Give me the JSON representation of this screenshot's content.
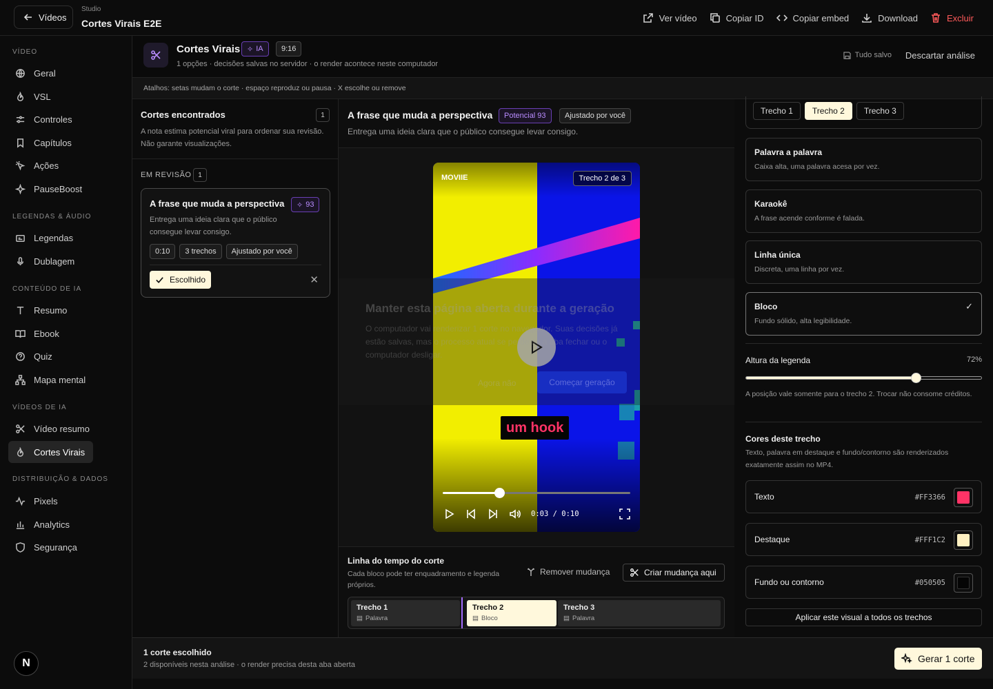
{
  "topbar": {
    "back_label": "Vídeos",
    "crumb_sub": "Studio",
    "crumb_title": "Cortes Virais E2E",
    "actions": [
      {
        "label": "Ver vídeo",
        "icon": "external-link-icon"
      },
      {
        "label": "Copiar ID",
        "icon": "copy-icon"
      },
      {
        "label": "Copiar embed",
        "icon": "code-icon"
      },
      {
        "label": "Download",
        "icon": "download-icon"
      },
      {
        "label": "Excluir",
        "icon": "trash-icon"
      }
    ]
  },
  "sidebar": {
    "sections": [
      {
        "title": "VÍDEO",
        "items": [
          "Geral",
          "VSL",
          "Controles",
          "Capítulos",
          "Ações",
          "PauseBoost"
        ]
      },
      {
        "title": "LEGENDAS & ÁUDIO",
        "items": [
          "Legendas",
          "Dublagem"
        ]
      },
      {
        "title": "CONTEÚDO DE IA",
        "items": [
          "Resumo",
          "Ebook",
          "Quiz",
          "Mapa mental"
        ]
      },
      {
        "title": "VÍDEOS DE IA",
        "items": [
          "Vídeo resumo",
          "Cortes Virais"
        ]
      },
      {
        "title": "DISTRIBUIÇÃO & DADOS",
        "items": [
          "Pixels",
          "Analytics",
          "Segurança"
        ]
      }
    ],
    "active": "Cortes Virais",
    "logo_letter": "N"
  },
  "header": {
    "title": "Cortes Virais",
    "tag_ia": "IA",
    "tag_ratio": "9:16",
    "subtitle": "1 opções · decisões salvas no servidor · o render acontece neste computador",
    "saved": "Tudo salvo",
    "discard": "Descartar análise"
  },
  "shortcuts": "Atalhos: setas mudam o corte · espaço reproduz ou pausa · X escolhe ou remove",
  "left_panel": {
    "title": "Cortes encontrados",
    "count": "1",
    "desc": "A nota estima potencial viral para ordenar sua revisão. Não garante visualizações.",
    "review_label": "EM REVISÃO",
    "review_count": "1",
    "card": {
      "title": "A frase que muda a perspectiva",
      "score": "93",
      "desc": "Entrega uma ideia clara que o público consegue levar consigo.",
      "chips": [
        "0:10",
        "3 trechos",
        "Ajustado por você"
      ],
      "chosen_label": "Escolhido"
    }
  },
  "center": {
    "title": "A frase que muda a perspectiva",
    "potential": "Potencial 93",
    "adjusted": "Ajustado por você",
    "desc": "Entrega uma ideia clara que o público consegue levar consigo.",
    "video": {
      "brand": "MOVIIE",
      "segment_badge": "Trecho 2 de 3",
      "caption": "um hook",
      "time": "0:03 / 0:10",
      "progress": 0.3
    },
    "overlay": {
      "title": "Manter esta página aberta durante a geração",
      "desc": "O computador vai renderizar 1 corte no navegador. Suas decisões já estão salvas, mas o processo atual se perde se a aba fechar ou o computador desligar.",
      "btn_no": "Agora não",
      "btn_start": "Começar geração"
    },
    "timeline": {
      "title": "Linha do tempo do corte",
      "desc": "Cada bloco pode ter enquadramento e legenda próprios.",
      "remove": "Remover mudança",
      "create": "Criar mudança aqui",
      "segments": [
        {
          "name": "Trecho 1",
          "style": "Palavra"
        },
        {
          "name": "Trecho 2",
          "style": "Bloco"
        },
        {
          "name": "Trecho 3",
          "style": "Palavra"
        }
      ]
    }
  },
  "right_panel": {
    "tabs": [
      "Trecho 1",
      "Trecho 2",
      "Trecho 3"
    ],
    "active_tab": "Trecho 2",
    "styles": [
      {
        "name": "Palavra a palavra",
        "desc": "Caixa alta, uma palavra acesa por vez."
      },
      {
        "name": "Karaokê",
        "desc": "A frase acende conforme é falada."
      },
      {
        "name": "Linha única",
        "desc": "Discreta, uma linha por vez."
      },
      {
        "name": "Bloco",
        "desc": "Fundo sólido, alta legibilidade."
      }
    ],
    "selected_style": "Bloco",
    "height_label": "Altura da legenda",
    "height_value": "72%",
    "height_fraction": 0.72,
    "height_note": "A posição vale somente para o trecho 2. Trocar não consome créditos.",
    "colors_title": "Cores deste trecho",
    "colors_desc": "Texto, palavra em destaque e fundo/contorno são renderizados exatamente assim no MP4.",
    "colors": [
      {
        "name": "Texto",
        "hex": "#FF3366"
      },
      {
        "name": "Destaque",
        "hex": "#FFF1C2"
      },
      {
        "name": "Fundo ou contorno",
        "hex": "#050505"
      }
    ],
    "apply_all": "Aplicar este visual a todos os trechos"
  },
  "footer": {
    "title": "1 corte escolhido",
    "desc": "2 disponíveis nesta análise · o render precisa desta aba aberta",
    "generate": "Gerar 1 corte"
  }
}
